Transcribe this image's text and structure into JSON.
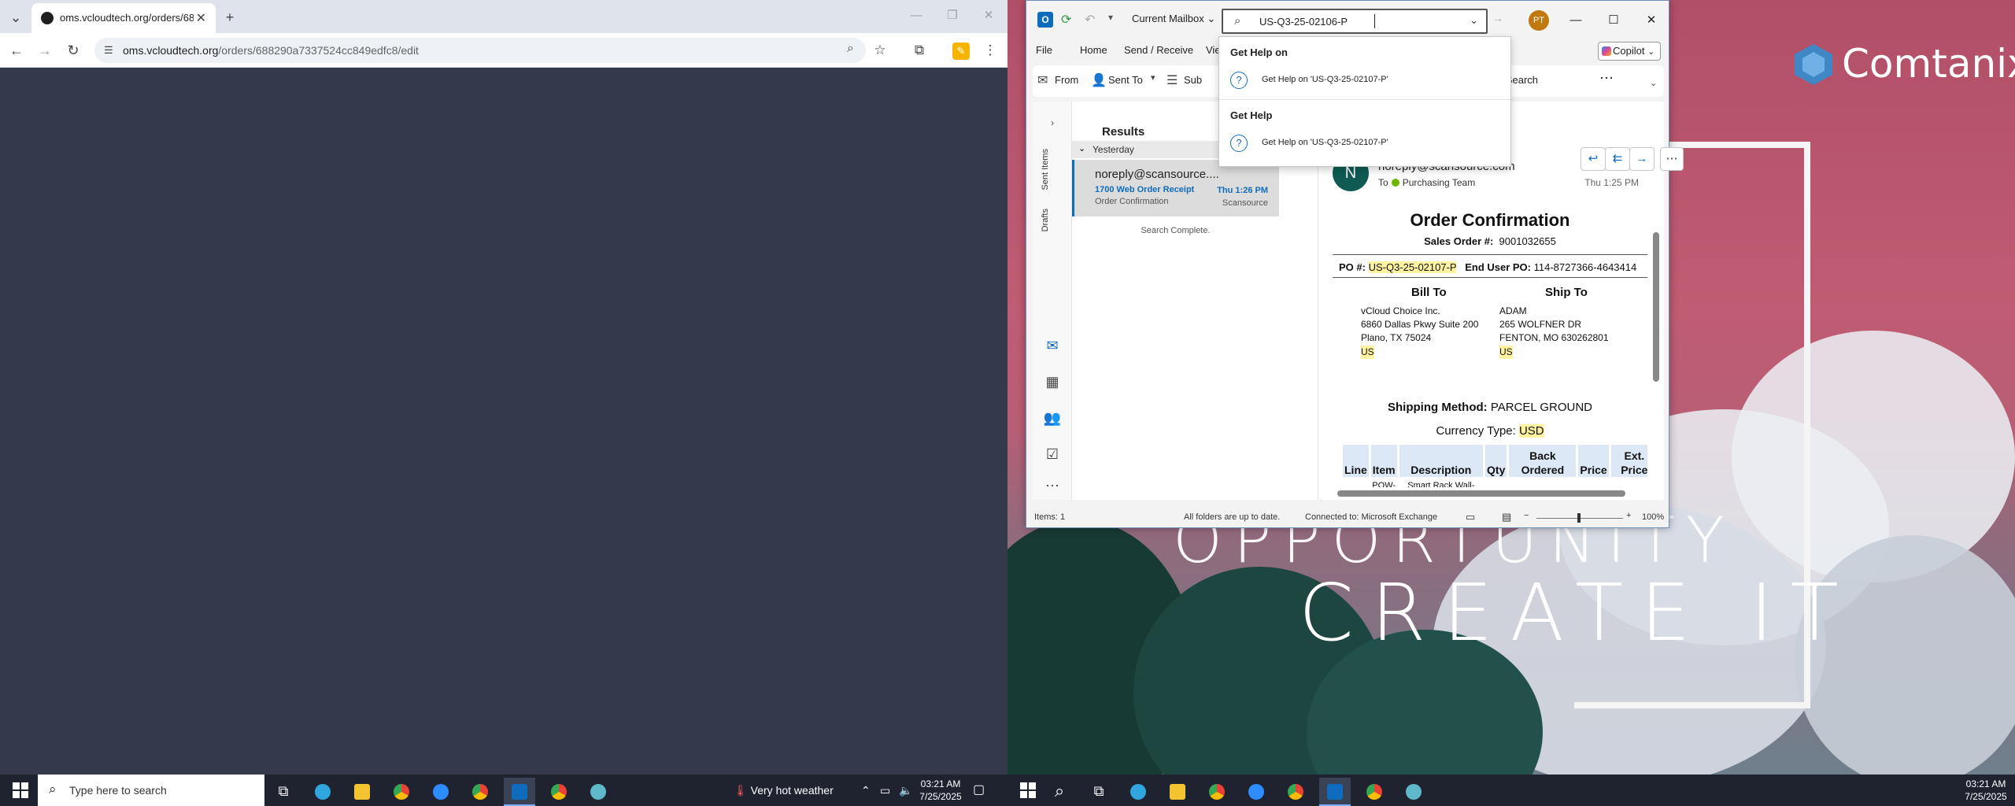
{
  "browser": {
    "tab_title": "oms.vcloudtech.org/orders/688",
    "url_host": "oms.vcloudtech.org",
    "url_path": "/orders/688290a7337524cc849edfc8/edit"
  },
  "left_taskbar": {
    "search_placeholder": "Type here to search",
    "weather": "Very hot weather",
    "time": "03:21 AM",
    "date": "7/25/2025"
  },
  "right_taskbar": {
    "time": "03:21 AM",
    "date": "7/25/2025"
  },
  "wallpaper": {
    "brand": "Comtanix",
    "line1": "OPPORTUNITY",
    "line2": "CREATE IT"
  },
  "outlook": {
    "mailbox_scope": "Current Mailbox",
    "search_value": "US-Q3-25-02106-P",
    "avatar_initials": "PT",
    "menu": [
      "File",
      "Home",
      "Send / Receive",
      "Vie"
    ],
    "copilot_label": "Copilot",
    "ribbon": {
      "from": "From",
      "sent_to": "Sent To",
      "subject": "Sub",
      "close_search": "Close Search",
      "more": "⋯"
    },
    "nav": {
      "sent_items": "Sent Items",
      "drafts": "Drafts",
      "more": "⋯"
    },
    "list": {
      "header": "Results",
      "group": "Yesterday",
      "items": [
        {
          "from": "noreply@scansource....",
          "subject": "1700 Web Order Receipt",
          "preview": "Order Confirmation",
          "time": "Thu 1:26 PM",
          "tag": "Scansource"
        }
      ],
      "status": "Search Complete."
    },
    "reading": {
      "avatar": "N",
      "from": "noreply@scansource.com",
      "to_label": "To",
      "to": "Purchasing Team",
      "date": "Thu 1:25 PM",
      "doc": {
        "title": "Order Confirmation",
        "sales_label": "Sales Order #:",
        "sales_value": "9001032655",
        "po_label": "PO #:",
        "po_value": "US-Q3-25-02107-P",
        "end_user_label": "End User PO:",
        "end_user_value": "114-8727366-4643414",
        "bill_to_head": "Bill To",
        "ship_to_head": "Ship To",
        "bill_to": [
          "vCloud Choice Inc.",
          "6860 Dallas Pkwy Suite 200",
          "Plano, TX 75024",
          "US"
        ],
        "ship_to": [
          "ADAM",
          "265 WOLFNER DR",
          "FENTON, MO 630262801",
          "US"
        ],
        "shipping_label": "Shipping Method:",
        "shipping_value": "PARCEL GROUND",
        "currency_label": "Currency Type:",
        "currency_value": "USD",
        "table_headers": [
          "Line",
          "Item",
          "Description",
          "Qty",
          "Back Ordered",
          "Price",
          "Ext. Price"
        ],
        "table_row": [
          "",
          "POW-",
          "Smart Rack Wall-Mount",
          "",
          "",
          "",
          ""
        ]
      }
    },
    "status": {
      "items": "Items: 1",
      "sync": "All folders are up to date.",
      "connection": "Connected to: Microsoft Exchange",
      "zoom": "100%"
    },
    "dropdown": {
      "section1": "Get Help on",
      "item1": "Get Help on 'US-Q3-25-02107-P'",
      "section2": "Get Help",
      "item2": "Get Help on 'US-Q3-25-02107-P'"
    }
  },
  "colors": {
    "outlook_blue": "#0f6cbd",
    "wallpaper_pink": "#b14f67",
    "chrome_bg": "#323a4c",
    "highlight": "#fff3a0"
  }
}
